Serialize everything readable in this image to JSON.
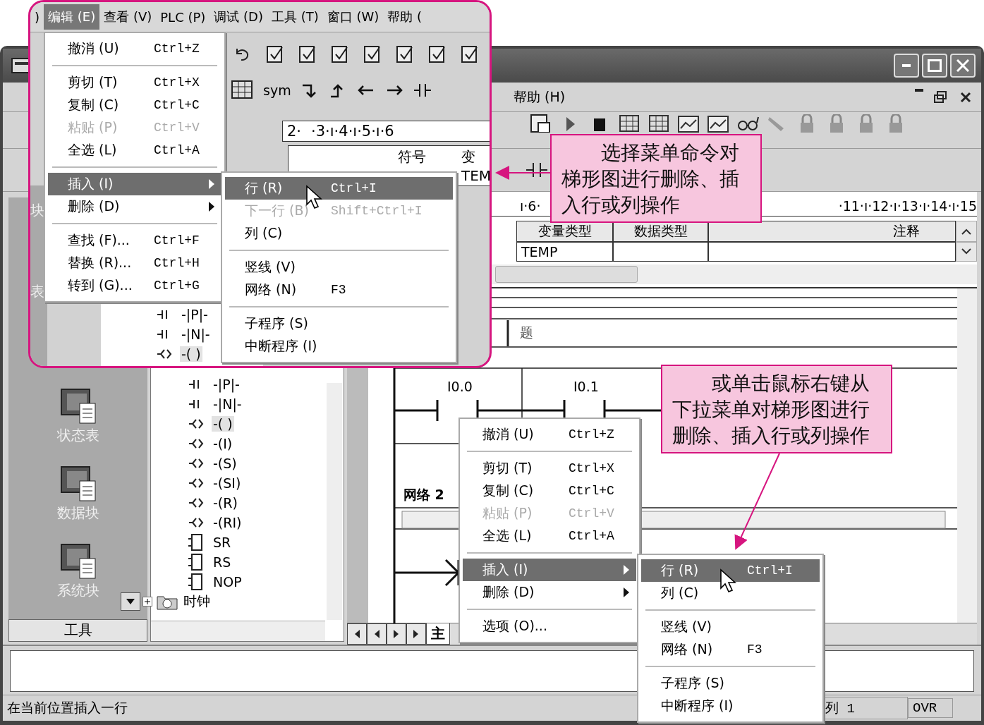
{
  "inset": {
    "menu_bar": [
      {
        "label": ")",
        "selected": false
      },
      {
        "label": "编辑 (E)",
        "selected": true
      },
      {
        "label": "查看 (V)",
        "selected": false
      },
      {
        "label": "PLC (P)",
        "selected": false
      },
      {
        "label": "调试 (D)",
        "selected": false
      },
      {
        "label": "工具 (T)",
        "selected": false
      },
      {
        "label": "窗口 (W)",
        "selected": false
      },
      {
        "label": "帮助 (",
        "selected": false
      }
    ],
    "toolbar_label": "sym",
    "ruler": [
      "2·",
      "·3·ı·4·ı·5·ı·6"
    ],
    "table_header": [
      "符号",
      "变"
    ],
    "table_cell": "TEM",
    "side_labels": [
      "块",
      "表"
    ],
    "tree": [
      {
        "kind": "contact",
        "label": "-|P|-",
        "selected": false
      },
      {
        "kind": "contact",
        "label": "-|N|-",
        "selected": false
      },
      {
        "kind": "coil",
        "label": "-( )",
        "selected": true
      }
    ],
    "edit_menu": [
      {
        "kind": "item",
        "label": "撤消 (U)",
        "shortcut": "Ctrl+Z",
        "selected": false,
        "disabled": false
      },
      {
        "kind": "separator"
      },
      {
        "kind": "item",
        "label": "剪切 (T)",
        "shortcut": "Ctrl+X",
        "selected": false,
        "disabled": false
      },
      {
        "kind": "item",
        "label": "复制 (C)",
        "shortcut": "Ctrl+C",
        "selected": false,
        "disabled": false
      },
      {
        "kind": "item",
        "label": "粘贴 (P)",
        "shortcut": "Ctrl+V",
        "selected": false,
        "disabled": true
      },
      {
        "kind": "item",
        "label": "全选 (L)",
        "shortcut": "Ctrl+A",
        "selected": false,
        "disabled": false
      },
      {
        "kind": "separator"
      },
      {
        "kind": "submenu",
        "label": "插入 (I)",
        "selected": true,
        "disabled": false
      },
      {
        "kind": "submenu",
        "label": "删除 (D)",
        "selected": false,
        "disabled": false
      },
      {
        "kind": "separator"
      },
      {
        "kind": "item",
        "label": "查找 (F)...",
        "shortcut": "Ctrl+F",
        "selected": false,
        "disabled": false
      },
      {
        "kind": "item",
        "label": "替换 (R)...",
        "shortcut": "Ctrl+H",
        "selected": false,
        "disabled": false
      },
      {
        "kind": "item",
        "label": "转到 (G)...",
        "shortcut": "Ctrl+G",
        "selected": false,
        "disabled": false
      }
    ],
    "insert_submenu": [
      {
        "kind": "item",
        "label": "行 (R)",
        "shortcut": "Ctrl+I",
        "selected": true,
        "disabled": false
      },
      {
        "kind": "item",
        "label": "下一行 (B)",
        "shortcut": "Shift+Ctrl+I",
        "selected": false,
        "disabled": true
      },
      {
        "kind": "item",
        "label": "列 (C)",
        "selected": false,
        "disabled": false
      },
      {
        "kind": "separator"
      },
      {
        "kind": "item",
        "label": "竖线 (V)",
        "selected": false,
        "disabled": false
      },
      {
        "kind": "item",
        "label": "网络 (N)",
        "shortcut": "F3",
        "selected": false,
        "disabled": false
      },
      {
        "kind": "separator"
      },
      {
        "kind": "item",
        "label": "子程序 (S)",
        "selected": false,
        "disabled": false
      },
      {
        "kind": "item",
        "label": "中断程序 (I)",
        "selected": false,
        "disabled": false
      }
    ]
  },
  "main_window": {
    "menu_bar": [
      "帮助 (H)"
    ],
    "ruler": [
      "ı·6·",
      "·11·ı·12·ı·13·ı·14·ı·15"
    ],
    "table": {
      "columns": [
        "变量类型",
        "数据类型",
        "注释"
      ],
      "rows": [
        [
          "TEMP"
        ]
      ]
    },
    "navbar": {
      "items": [
        "状态表",
        "数据块",
        "系统块"
      ],
      "footer_button": "工具"
    },
    "tree": [
      {
        "kind": "contact",
        "label": "-|P|-",
        "selected": false
      },
      {
        "kind": "contact",
        "label": "-|N|-",
        "selected": false
      },
      {
        "kind": "coil",
        "label": "-( )",
        "selected": true
      },
      {
        "kind": "coil",
        "label": "-(I)",
        "selected": false
      },
      {
        "kind": "coil",
        "label": "-(S)",
        "selected": false
      },
      {
        "kind": "coil",
        "label": "-(SI)",
        "selected": false
      },
      {
        "kind": "coil",
        "label": "-(R)",
        "selected": false
      },
      {
        "kind": "coil",
        "label": "-(RI)",
        "selected": false
      },
      {
        "kind": "box",
        "label": "SR",
        "selected": false
      },
      {
        "kind": "box",
        "label": "RS",
        "selected": false
      },
      {
        "kind": "box",
        "label": "NOP",
        "selected": false
      },
      {
        "kind": "folder",
        "label": "时钟",
        "expanded": false,
        "selected": false
      }
    ],
    "ladder": {
      "title_fragment": "题",
      "contacts": [
        "I0.0",
        "I0.1"
      ],
      "network_2": "网络 2"
    },
    "tabs": [
      {
        "label": "主",
        "selected": true
      }
    ],
    "status_bar": {
      "message": "在当前位置插入一行",
      "position": "列 1",
      "mode": "OVR"
    }
  },
  "callouts": [
    {
      "text": "选择菜单命令对梯形图进行删除、插入行或列操作"
    },
    {
      "text": "或单击鼠标右键从下拉菜单对梯形图进行删除、插入行或列操作"
    }
  ],
  "context_menu": [
    {
      "kind": "item",
      "label": "撤消 (U)",
      "shortcut": "Ctrl+Z",
      "selected": false,
      "disabled": false
    },
    {
      "kind": "separator"
    },
    {
      "kind": "item",
      "label": "剪切 (T)",
      "shortcut": "Ctrl+X",
      "selected": false,
      "disabled": false
    },
    {
      "kind": "item",
      "label": "复制 (C)",
      "shortcut": "Ctrl+C",
      "selected": false,
      "disabled": false
    },
    {
      "kind": "item",
      "label": "粘贴 (P)",
      "shortcut": "Ctrl+V",
      "selected": false,
      "disabled": true
    },
    {
      "kind": "item",
      "label": "全选 (L)",
      "shortcut": "Ctrl+A",
      "selected": false,
      "disabled": false
    },
    {
      "kind": "separator"
    },
    {
      "kind": "submenu",
      "label": "插入 (I)",
      "selected": true,
      "disabled": false
    },
    {
      "kind": "submenu",
      "label": "删除 (D)",
      "selected": false,
      "disabled": false
    },
    {
      "kind": "separator"
    },
    {
      "kind": "item",
      "label": "选项 (O)...",
      "selected": false,
      "disabled": false
    }
  ],
  "context_submenu": [
    {
      "kind": "item",
      "label": "行 (R)",
      "shortcut": "Ctrl+I",
      "selected": true,
      "disabled": false
    },
    {
      "kind": "item",
      "label": "列 (C)",
      "selected": false,
      "disabled": false
    },
    {
      "kind": "separator"
    },
    {
      "kind": "item",
      "label": "竖线 (V)",
      "selected": false,
      "disabled": false
    },
    {
      "kind": "item",
      "label": "网络 (N)",
      "shortcut": "F3",
      "selected": false,
      "disabled": false
    },
    {
      "kind": "separator"
    },
    {
      "kind": "item",
      "label": "子程序 (S)",
      "selected": false,
      "disabled": false
    },
    {
      "kind": "item",
      "label": "中断程序 (I)",
      "selected": false,
      "disabled": false
    }
  ]
}
